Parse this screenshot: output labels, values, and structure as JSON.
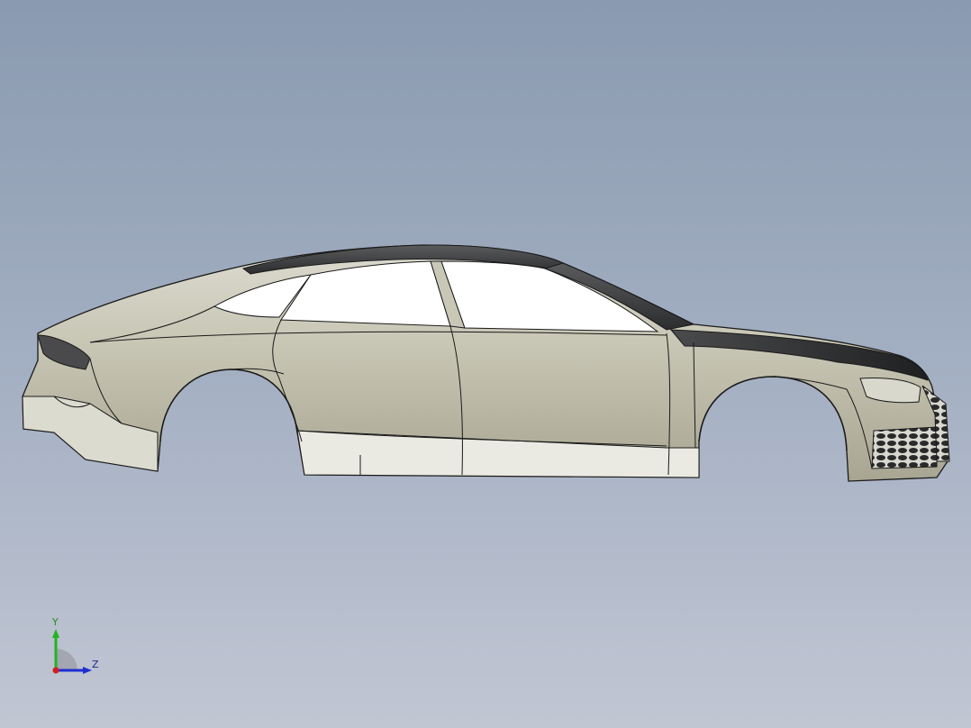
{
  "viewport": {
    "background_top": "#8a9ab0",
    "background_bottom": "#c1c6d3"
  },
  "model": {
    "body_color": "#c9c7b6",
    "roof_color": "#3a3b3d",
    "glass_color": "#ffffff",
    "edge_color": "#1a1a1a"
  },
  "triad": {
    "y_label": "Y",
    "z_label": "Z",
    "y_color": "#22b422",
    "z_color": "#1e2dd2",
    "x_color": "#d21e1e"
  }
}
